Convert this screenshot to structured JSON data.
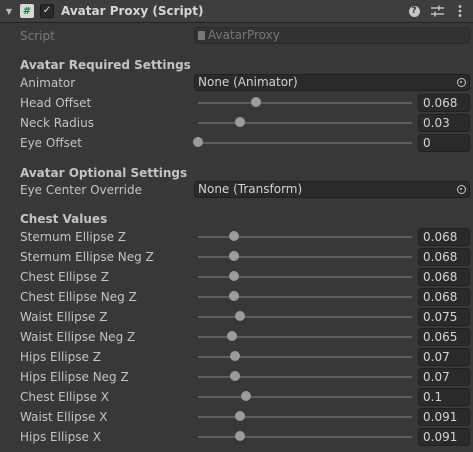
{
  "header": {
    "fold_icon": "triangle-down-icon",
    "script_icon": "csharp-script-icon",
    "enabled": true,
    "check_glyph": "✓",
    "title": "Avatar Proxy (Script)",
    "icons": [
      "help-icon",
      "settings-sliders-icon",
      "kebab-menu-icon"
    ]
  },
  "script_row": {
    "label": "Script",
    "value": "AvatarProxy"
  },
  "required": {
    "heading": "Avatar Required Settings",
    "animator": {
      "label": "Animator",
      "value": "None (Animator)"
    },
    "sliders": [
      {
        "label": "Head Offset",
        "value": "0.068",
        "fraction": 0.27
      },
      {
        "label": "Neck Radius",
        "value": "0.03",
        "fraction": 0.195
      },
      {
        "label": "Eye Offset",
        "value": "0",
        "fraction": 0.0
      }
    ]
  },
  "optional": {
    "heading": "Avatar Optional Settings",
    "eye_center": {
      "label": "Eye Center Override",
      "value": "None (Transform)"
    }
  },
  "chest": {
    "heading": "Chest Values",
    "sliders": [
      {
        "label": "Sternum Ellipse Z",
        "value": "0.068",
        "fraction": 0.17
      },
      {
        "label": "Sternum Ellipse Neg Z",
        "value": "0.068",
        "fraction": 0.17
      },
      {
        "label": "Chest Ellipse Z",
        "value": "0.068",
        "fraction": 0.17
      },
      {
        "label": "Chest Ellipse Neg Z",
        "value": "0.068",
        "fraction": 0.17
      },
      {
        "label": "Waist Ellipse Z",
        "value": "0.075",
        "fraction": 0.195
      },
      {
        "label": "Waist Ellipse Neg Z",
        "value": "0.065",
        "fraction": 0.16
      },
      {
        "label": "Hips Ellipse Z",
        "value": "0.07",
        "fraction": 0.175
      },
      {
        "label": "Hips Ellipse Neg Z",
        "value": "0.07",
        "fraction": 0.175
      },
      {
        "label": "Chest Ellipse X",
        "value": "0.1",
        "fraction": 0.225
      },
      {
        "label": "Waist Ellipse X",
        "value": "0.091",
        "fraction": 0.195
      },
      {
        "label": "Hips Ellipse X",
        "value": "0.091",
        "fraction": 0.195
      }
    ]
  }
}
